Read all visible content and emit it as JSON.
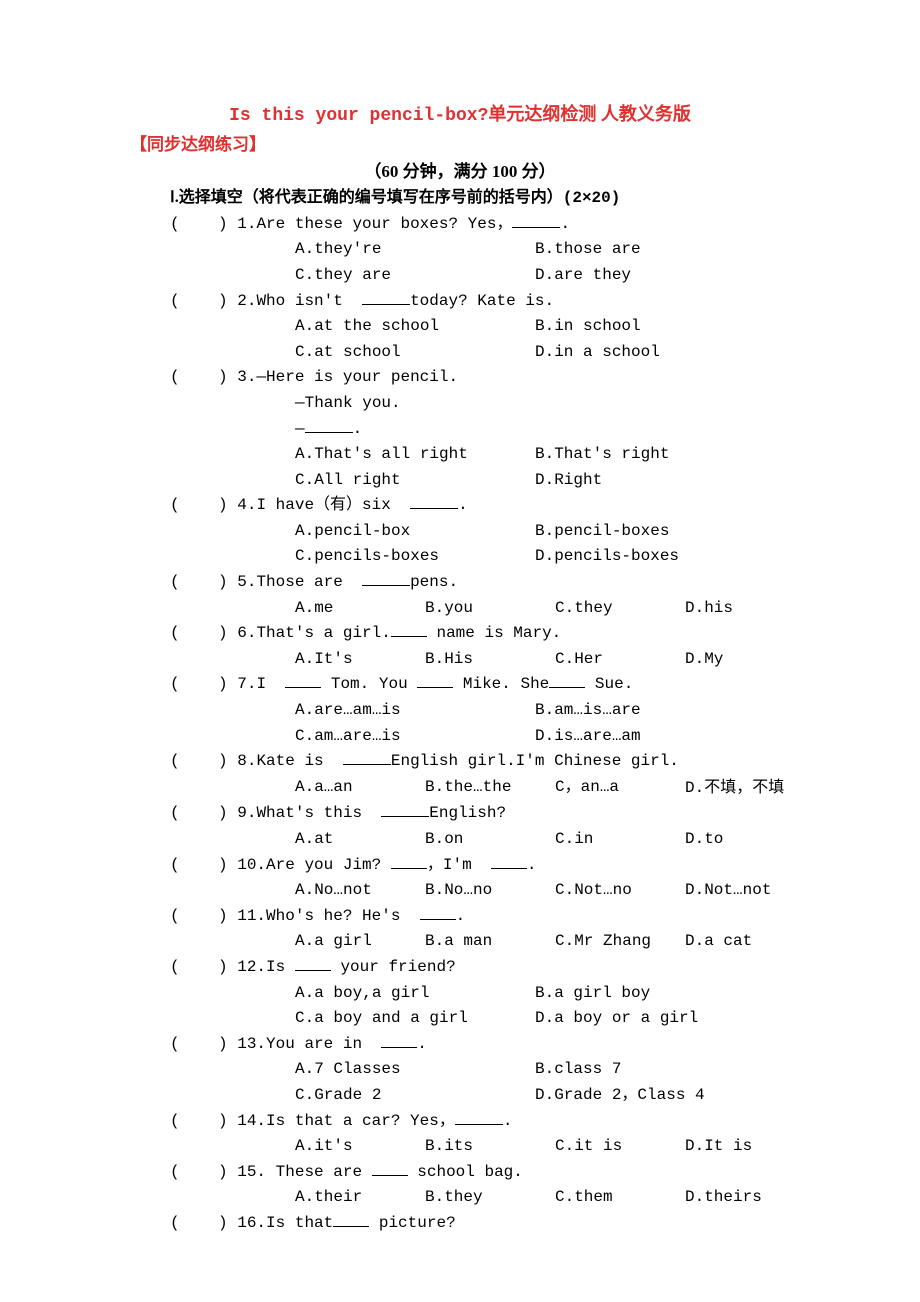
{
  "title_en": "Is this your pencil-box?",
  "title_cn": "单元达纲检测 人教义务版",
  "subheading": "【同步达纲练习】",
  "timing": "（60 分钟，满分 100 分）",
  "section1_label_roman": "Ⅰ.",
  "section1_label_name": "选择填空",
  "section1_label_note": "（将代表正确的编号填写在序号前的括号内）(2×20)",
  "questions": [
    {
      "num": "1",
      "stem_a": "Are these your boxes? Yes，",
      "layout": "2col",
      "opts": {
        "A": "they're",
        "B": "those are",
        "C": "they are",
        "D": "are they"
      }
    },
    {
      "num": "2",
      "stem_a": "Who isn't ",
      "stem_b": "today? Kate is.",
      "layout": "2col",
      "opts": {
        "A": "at the school",
        "B": "in school",
        "C": "at school",
        "D": "in a school"
      }
    },
    {
      "num": "3",
      "stem_a": "—Here is your pencil.",
      "line2": "—Thank you.",
      "line3": "—",
      "line3_end": ".",
      "layout": "2col",
      "opts": {
        "A": "That's all right",
        "B": "That's right",
        "C": "All right",
        "D": "Right"
      }
    },
    {
      "num": "4",
      "stem_a": "I have（有）six ",
      "stem_end": ".",
      "layout": "2col",
      "opts": {
        "A": "pencil-box",
        "B": "pencil-boxes",
        "C": "pencils-boxes",
        "D": "pencils-boxes"
      }
    },
    {
      "num": "5",
      "stem_a": "Those are ",
      "stem_b": "pens.",
      "layout": "4col",
      "opts": {
        "A": "me",
        "B": "you",
        "C": "they",
        "D": "his"
      }
    },
    {
      "num": "6",
      "stem_a": "That's a girl.",
      "stem_b": " name is Mary.",
      "layout": "4col",
      "opts": {
        "A": "It's",
        "B": "His",
        "C": "Her",
        "D": "My"
      }
    },
    {
      "num": "7",
      "stem_a": "I ",
      "stem_b": " Tom. You ",
      "stem_c": " Mike. She",
      "stem_d": " Sue.",
      "layout": "2col",
      "opts": {
        "A": "are…am…is",
        "B": "am…is…are",
        "C": "am…are…is",
        "D": "is…are…am"
      }
    },
    {
      "num": "8",
      "stem_a": "Kate is ",
      "stem_b": "English girl.I'm Chinese girl.",
      "layout": "4col",
      "opts": {
        "A": "a…an",
        "B": "the…the",
        "C": "，an…a",
        "D": "不填，不填"
      }
    },
    {
      "num": "9",
      "stem_a": "What's this ",
      "stem_b": "English?",
      "layout": "4col",
      "opts": {
        "A": "at",
        "B": "on",
        "C": "in",
        "D": "to"
      }
    },
    {
      "num": "10",
      "stem_a": "Are you Jim? ",
      "stem_b": "，I'm ",
      "stem_end": ".",
      "layout": "4col",
      "opts": {
        "A": "No…not",
        "B": "No…no",
        "C": "Not…no",
        "D": "Not…not"
      }
    },
    {
      "num": "11",
      "stem_a": "Who's he? He's ",
      "stem_end": ".",
      "layout": "4col",
      "opts": {
        "A": "a girl",
        "B": "a man",
        "C": "Mr Zhang",
        "D": "a cat"
      }
    },
    {
      "num": "12",
      "stem_a": "Is ",
      "stem_b": " your friend?",
      "layout": "2col",
      "opts": {
        "A": "a boy,a girl",
        "B": "a girl boy",
        "C": "a boy and a girl",
        "D": "a boy or a girl"
      }
    },
    {
      "num": "13",
      "stem_a": "You are in ",
      "stem_end": ".",
      "layout": "2col",
      "opts": {
        "A": "7 Classes",
        "B": "class 7",
        "C": "Grade 2",
        "D": "Grade 2，Class 4"
      }
    },
    {
      "num": "14",
      "stem_a": "Is that a car? Yes，",
      "stem_end": ".",
      "layout": "4col",
      "opts": {
        "A": "it's",
        "B": "its",
        "C": "it is",
        "D": "It is"
      }
    },
    {
      "num": "15",
      "stem_a": " These are ",
      "stem_b": " school  bag.",
      "layout": "4col",
      "opts": {
        "A": "their",
        "B": "they",
        "C": "them",
        "D": "theirs"
      }
    },
    {
      "num": "16",
      "stem_a": "Is that",
      "stem_b": " picture?",
      "layout": "none"
    }
  ]
}
